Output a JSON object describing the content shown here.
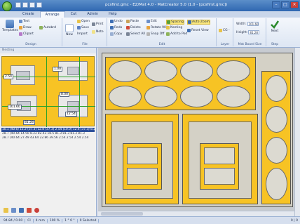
{
  "titlebar": {
    "title": "pcsfirst.gmc - EZ/Mat 4.0 - MatCreator 5.0 (1.0 - [pcsfirst.gmc])",
    "minimize": "–",
    "maximize": "□",
    "close": "×"
  },
  "tabs": [
    "Create",
    "Arrange",
    "Cut",
    "Admin",
    "Help"
  ],
  "ribbon": {
    "design": {
      "label": "Design",
      "templates": "Templates",
      "text": "Text",
      "draw": "Draw",
      "autobrd": "Autobrd",
      "clipart": "Clipart"
    },
    "file": {
      "label": "File",
      "new": "New",
      "open": "Open",
      "save": "Save",
      "import": "Import",
      "print": "Print",
      "note": "Note"
    },
    "edit": {
      "label": "Edit",
      "undo": "Undo",
      "redo": "Redo",
      "copy": "Copy",
      "paste": "Paste",
      "delete": "Delete",
      "select_all": "Select All",
      "edit": "Edit",
      "rotate": "Rotate 90°",
      "snap_off": "Snap Off",
      "spacing": "Spacing",
      "nesting": "Nesting",
      "add_to_pod": "Add to Pod",
      "auto_zoom": "Auto Zoom",
      "reset_view": "Reset View"
    },
    "layer": {
      "label": "Layer",
      "cg": "CG -"
    },
    "mat_board": {
      "label": "Mat Board Size",
      "width_label": "Width:",
      "width": "101.60",
      "height_label": "Height:",
      "height": "81.28"
    },
    "step": {
      "label": "Step",
      "next": "Next"
    }
  },
  "left_panel": {
    "header": "Nesting",
    "measurements": [
      "1.00",
      "2.54",
      "8.00",
      "101.60",
      "12.54",
      "81.28",
      "0.00"
    ],
    "rows": [
      "10.1 (40.6) 11.2 (37.3) 12.8 (37.3) 2.54 (10.0) 12.6 (37.3) 8.25",
      "28.7 (40.64 14.50 8.33 82.43 18.5 81.3 81.3 81.3 81.3",
      "28.7 (40.64 27.49 43.64 22.86 39.56 2.54 2.54 2.54 2.54"
    ],
    "selected_row": 0
  },
  "statusbar": {
    "coords": "94.84 / 0.00",
    "units": "CI",
    "unit_mm": "4 mm",
    "zoom": "100 %",
    "grid": "1 ° 0 °",
    "selected": "0 Selected",
    "right": "0 | 0"
  },
  "colors": {
    "mat": "#f7c324",
    "board": "#d4d1c6",
    "opening": "#dcdad1",
    "accent": "#2c4f9a"
  }
}
